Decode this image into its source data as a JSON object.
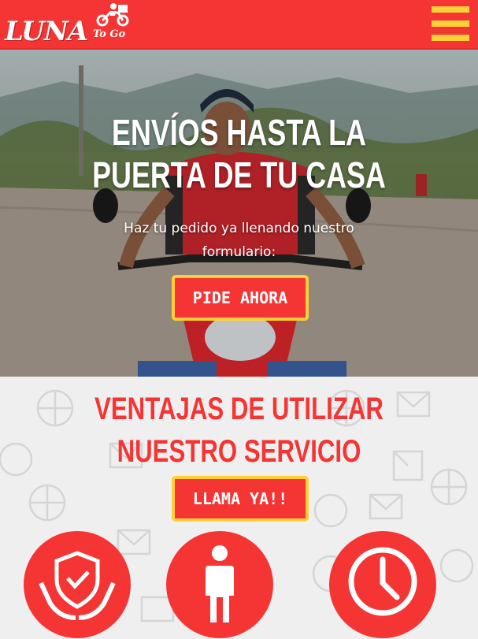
{
  "header": {
    "logo_main": "LUNA",
    "logo_sub": "To Go",
    "menu_icon": "hamburger-menu-icon",
    "colors": {
      "brand_red": "#f43534",
      "accent_yellow": "#ffcf3a"
    }
  },
  "hero": {
    "title_line1": "ENVÍOS HASTA LA",
    "title_line2": "PUERTA DE TU CASA",
    "subtitle": "Haz tu pedido ya llenando nuestro formulario:",
    "cta_label": "PIDE AHORA"
  },
  "ventajas": {
    "title_line1": "VENTAJAS DE UTILIZAR",
    "title_line2": "NUESTRO SERVICIO",
    "cta_label": "LLAMA YA!!",
    "icons": [
      "shield-check-hands-icon",
      "person-icon",
      "clock-icon"
    ]
  }
}
